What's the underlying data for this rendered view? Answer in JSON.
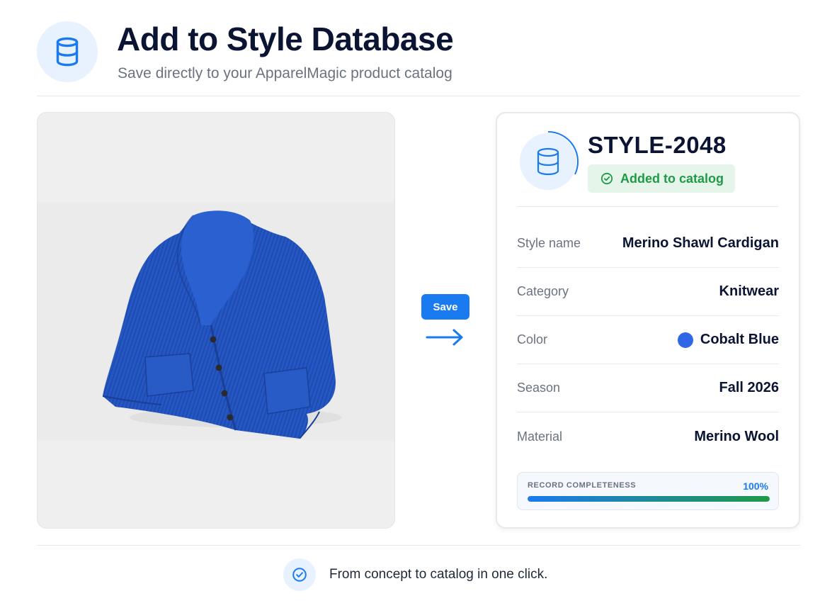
{
  "header": {
    "icon": "database-icon",
    "title": "Add to Style Database",
    "subtitle": "Save directly to your ApparelMagic product catalog"
  },
  "product_image": {
    "description_icon": "cardigan-image",
    "garment_color": "#2456c4"
  },
  "action": {
    "save_label": "Save",
    "arrow_icon": "arrow-right-icon"
  },
  "record": {
    "icon": "database-icon",
    "style_id": "STYLE-2048",
    "status": {
      "icon": "check-circle-icon",
      "label": "Added to catalog",
      "color": "#1f9a46"
    },
    "fields": [
      {
        "label": "Style name",
        "value": "Merino Shawl Cardigan"
      },
      {
        "label": "Category",
        "value": "Knitwear"
      },
      {
        "label": "Color",
        "value": "Cobalt Blue",
        "swatch": "#2f67e6"
      },
      {
        "label": "Season",
        "value": "Fall 2026"
      },
      {
        "label": "Material",
        "value": "Merino Wool"
      }
    ],
    "completeness": {
      "label": "RECORD COMPLETENESS",
      "percent_label": "100%",
      "value": 1.0
    }
  },
  "footer": {
    "icon": "check-circle-icon",
    "text": "From concept to catalog in one click."
  },
  "colors": {
    "accent": "#1a7af0",
    "success": "#1f9a46",
    "heading": "#0b1533",
    "muted": "#6b7280"
  }
}
